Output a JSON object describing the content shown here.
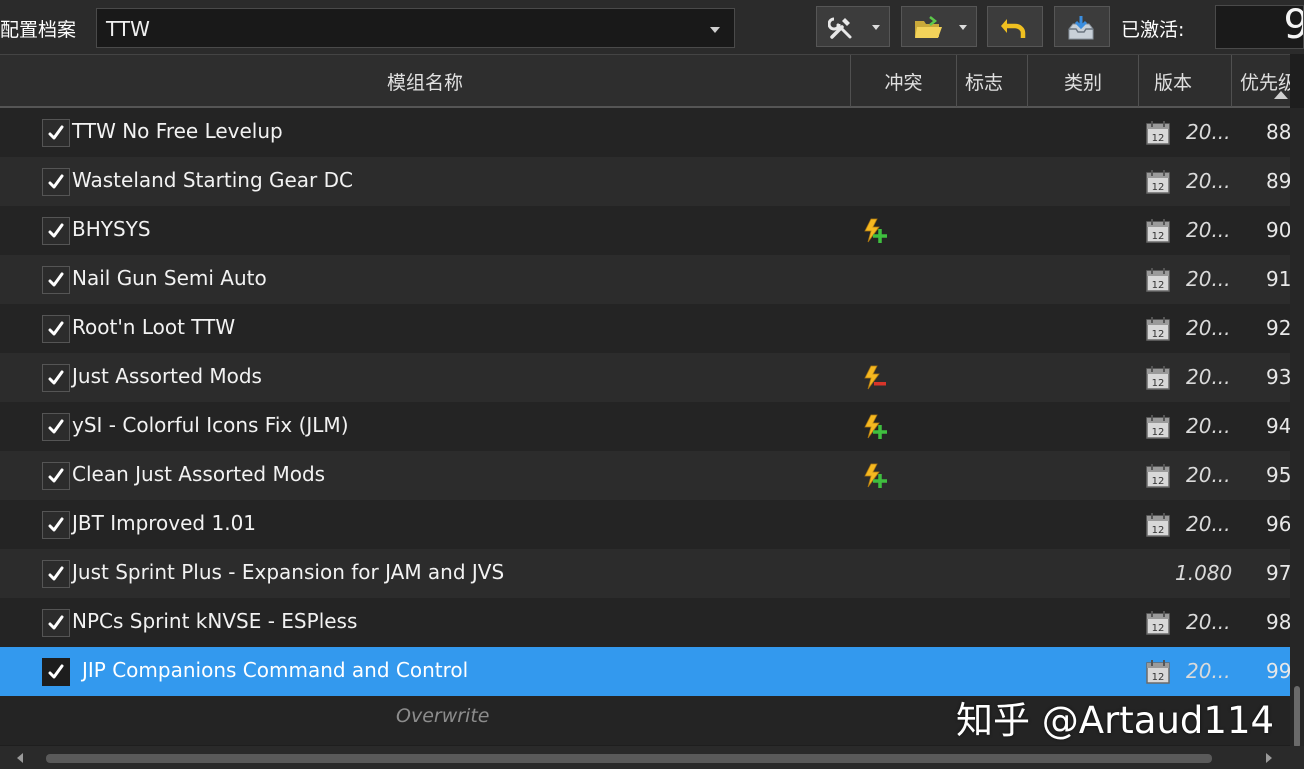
{
  "toolbar": {
    "profile_label": "配置档案",
    "profile_value": "TTW",
    "active_label": "已激活:",
    "active_count": "9",
    "buttons": [
      "tools-icon",
      "open-folder-icon",
      "undo-icon",
      "inbox-icon"
    ]
  },
  "columns": {
    "name": "模组名称",
    "conflicts": "冲突",
    "flags": "标志",
    "category": "类别",
    "version": "版本",
    "priority": "优先级"
  },
  "rows": [
    {
      "name": "TTW No Free Levelup",
      "version": "20...",
      "priority": "88",
      "conflict": "",
      "date_icon": "calendar-icon"
    },
    {
      "name": "Wasteland Starting Gear DC",
      "version": "20...",
      "priority": "89",
      "conflict": "",
      "date_icon": "calendar-icon"
    },
    {
      "name": "BHYSYS",
      "version": "20...",
      "priority": "90",
      "conflict": "overwrite-plus-icon",
      "date_icon": "calendar-icon"
    },
    {
      "name": "Nail Gun Semi Auto",
      "version": "20...",
      "priority": "91",
      "conflict": "",
      "date_icon": "calendar-icon"
    },
    {
      "name": "Root'n Loot TTW",
      "version": "20...",
      "priority": "92",
      "conflict": "",
      "date_icon": "calendar-icon"
    },
    {
      "name": "Just Assorted Mods",
      "version": "20...",
      "priority": "93",
      "conflict": "overwritten-minus-icon",
      "date_icon": "calendar-icon"
    },
    {
      "name": "ySI - Colorful Icons Fix (JLM)",
      "version": "20...",
      "priority": "94",
      "conflict": "overwrite-plus-icon",
      "date_icon": "calendar-icon"
    },
    {
      "name": "Clean Just Assorted Mods",
      "version": "20...",
      "priority": "95",
      "conflict": "overwrite-plus-icon",
      "date_icon": "calendar-icon"
    },
    {
      "name": "JBT Improved 1.01",
      "version": "20...",
      "priority": "96",
      "conflict": "",
      "date_icon": "calendar-icon"
    },
    {
      "name": "Just Sprint Plus - Expansion for JAM and JVS",
      "version": "1.080",
      "priority": "97",
      "conflict": "",
      "date_icon": ""
    },
    {
      "name": "NPCs Sprint kNVSE - ESPless",
      "version": "20...",
      "priority": "98",
      "conflict": "",
      "date_icon": "calendar-icon"
    },
    {
      "name": "JIP Companions Command and Control",
      "version": "20...",
      "priority": "99",
      "conflict": "",
      "date_icon": "calendar-icon",
      "selected": true
    }
  ],
  "overwrite_label": "Overwrite",
  "watermark": "知乎 @Artaud114",
  "colors": {
    "selection": "#3399ee",
    "background": "#1e1e1e",
    "row_alt": "#2c2c2c"
  }
}
